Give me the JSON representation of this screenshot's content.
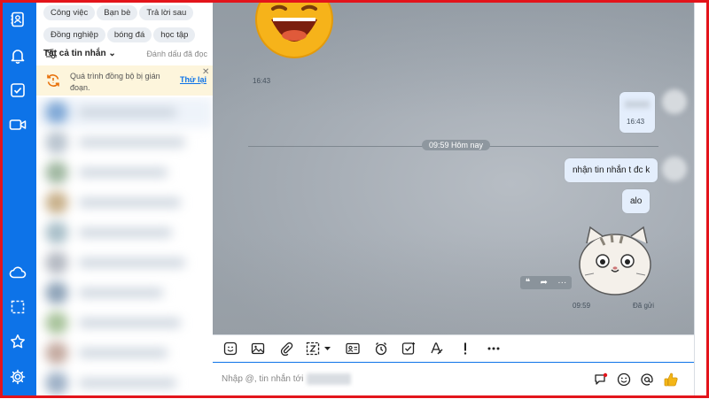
{
  "tags": [
    "Công việc",
    "Bạn bè",
    "Trả lời sau",
    "Đồng nghiệp",
    "bóng đá",
    "học tập"
  ],
  "list_header": {
    "all_messages": "Tất cả tin nhắn",
    "mark_read": "Đánh dấu đã đọc"
  },
  "sync_banner": {
    "message": "Quá trình đồng bộ bị gián đoạn.",
    "retry": "Thử lại"
  },
  "messages": {
    "sticker_laugh_time": "16:43",
    "blurred_time": "16:43",
    "divider": "09:59 Hôm nay",
    "msg1": "nhận tin nhắn t đc k",
    "msg2": "alo",
    "sticker_time": "09:59",
    "status": "Đã gửi"
  },
  "composer": {
    "placeholder": "Nhập @, tin nhắn tới"
  },
  "colors": {
    "rail": "#0d73e8",
    "bubble": "#e4eefc",
    "banner": "#fdf5dc",
    "frame": "#e3141b"
  },
  "icons": {
    "rail_top": [
      "contacts-icon",
      "bell-icon",
      "todo-check-icon",
      "video-icon"
    ],
    "rail_bottom": [
      "cloud-icon",
      "screenshot-icon",
      "star-icon",
      "settings-icon"
    ],
    "toolbar": [
      "sticker-icon",
      "image-icon",
      "attach-icon",
      "capture-icon",
      "contact-card-icon",
      "reminder-icon",
      "task-icon",
      "format-text-icon",
      "urgent-icon",
      "more-icon"
    ],
    "composer": [
      "quick-message-icon",
      "emoji-icon",
      "mention-icon",
      "thumbs-up-icon"
    ]
  }
}
